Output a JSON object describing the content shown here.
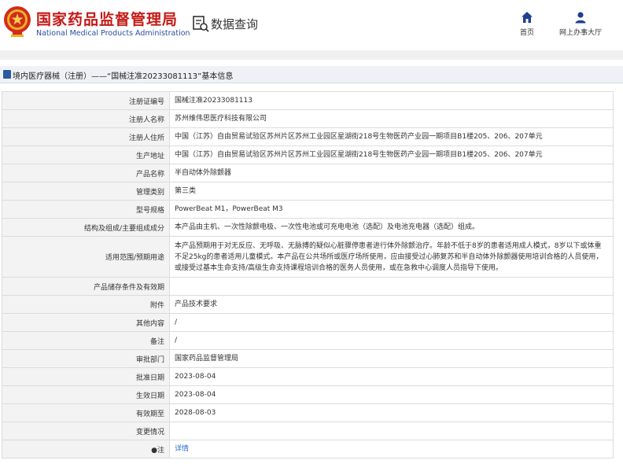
{
  "header": {
    "site_title": "国家药品监督管理局",
    "site_subtitle": "National Medical Products Administration",
    "data_query": "数据查询",
    "nav": [
      {
        "label": "首页",
        "icon": "home-icon"
      },
      {
        "label": "网上办事大厅",
        "icon": "user-icon"
      }
    ]
  },
  "breadcrumb": "境内医疗器械（注册）——“国械注准20233081113”基本信息",
  "table": {
    "rows": [
      {
        "label": "注册证编号",
        "value": "国械注准20233081113"
      },
      {
        "label": "注册人名称",
        "value": "苏州维伟思医疗科技有限公司"
      },
      {
        "label": "注册人住所",
        "value": "中国（江苏）自由贸易试验区苏州片区苏州工业园区星湖街218号生物医药产业园一期项目B1楼205、206、207单元"
      },
      {
        "label": "生产地址",
        "value": "中国（江苏）自由贸易试验区苏州片区苏州工业园区星湖街218号生物医药产业园一期项目B1楼205、206、207单元"
      },
      {
        "label": "产品名称",
        "value": "半自动体外除颤器"
      },
      {
        "label": "管理类别",
        "value": "第三类"
      },
      {
        "label": "型号规格",
        "value": "PowerBeat M1，PowerBeat M3"
      },
      {
        "label": "结构及组成/主要组成成分",
        "value": "本产品由主机、一次性除颤电极、一次性电池或可充电电池（选配）及电池充电器（选配）组成。"
      },
      {
        "label": "适用范围/预期用途",
        "value": "本产品预期用于对无反应、无呼吸、无脉搏的疑似心脏骤停患者进行体外除颤治疗。年龄不低于8岁的患者适用成人模式，8岁以下或体重不足25kg的患者适用儿童模式。本产品在公共场所或医疗场所使用，应由接受过心肺复苏和半自动体外除颤器使用培训合格的人员使用，或接受过基本生命支持/高级生命支持课程培训合格的医务人员使用，或在急救中心调度人员指导下使用。"
      },
      {
        "label": "产品储存条件及有效期",
        "value": ""
      },
      {
        "label": "附件",
        "value": "产品技术要求"
      },
      {
        "label": "其他内容",
        "value": "/"
      },
      {
        "label": "备注",
        "value": "/"
      },
      {
        "label": "审批部门",
        "value": "国家药品监督管理局"
      },
      {
        "label": "批准日期",
        "value": "2023-08-04"
      },
      {
        "label": "生效日期",
        "value": "2023-08-04"
      },
      {
        "label": "有效期至",
        "value": "2028-08-03"
      },
      {
        "label": "变更情况",
        "value": ""
      },
      {
        "label": "●注",
        "value": "详情"
      }
    ]
  },
  "colors": {
    "title_red": "#c41a16",
    "subtitle_blue": "#2a4fa0",
    "link_blue": "#2a6bd1",
    "label_bg": "#f3f3f3"
  }
}
